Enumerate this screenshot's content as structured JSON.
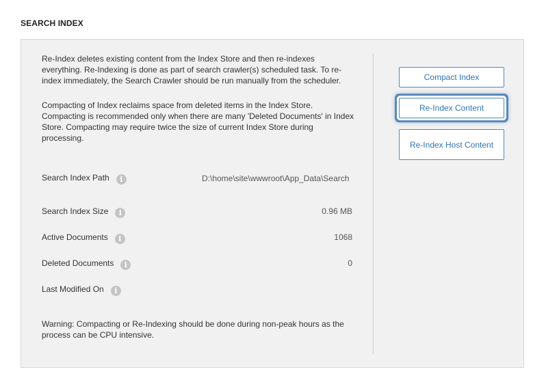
{
  "section_title": "SEARCH INDEX",
  "description": {
    "reindex": "Re-Index deletes existing content from the Index Store and then re-indexes everything. Re-Indexing is done as part of search crawler(s) scheduled task. To re-index immediately, the Search Crawler should be run manually from the scheduler.",
    "compact": "Compacting of Index reclaims space from deleted items in the Index Store. Compacting is recommended only when there are many 'Deleted Documents' in Index Store. Compacting may require twice the size of current Index Store during processing."
  },
  "info": {
    "path": {
      "label": "Search Index Path",
      "value": "D:\\home\\site\\wwwroot\\App_Data\\Search"
    },
    "size": {
      "label": "Search Index Size",
      "value": "0.96 MB"
    },
    "active": {
      "label": "Active Documents",
      "value": "1068"
    },
    "deleted": {
      "label": "Deleted Documents",
      "value": "0"
    },
    "modified": {
      "label": "Last Modified On",
      "value": ""
    }
  },
  "info_icon_glyph": "i",
  "warning": "Warning: Compacting or Re-Indexing should be done during non-peak hours as the process can be CPU intensive.",
  "buttons": {
    "compact": "Compact Index",
    "reindex": "Re-Index Content",
    "reindex_host": "Re-Index Host Content"
  },
  "colors": {
    "accent": "#2f74b5",
    "focus_ring": "#5b88bd",
    "panel_bg": "#f1f1f1"
  }
}
